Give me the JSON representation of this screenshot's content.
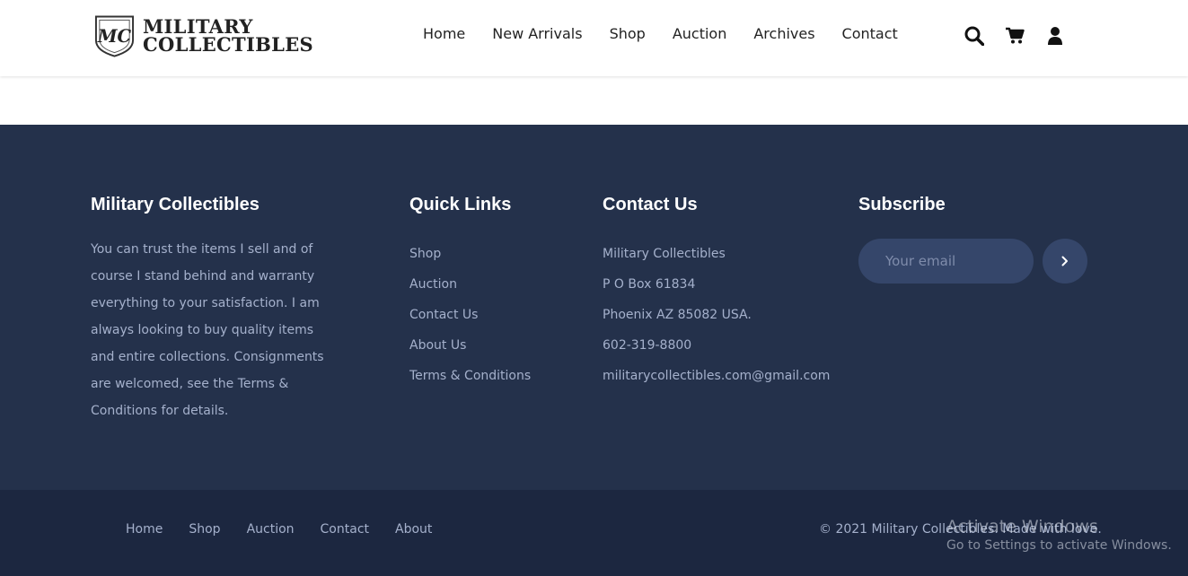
{
  "header": {
    "logo_line1": "MILITARY",
    "logo_line2": "COLLECTIBLES",
    "logo_monogram": "MC",
    "nav": [
      "Home",
      "New Arrivals",
      "Shop",
      "Auction",
      "Archives",
      "Contact"
    ],
    "icons": [
      "search-icon",
      "cart-icon",
      "user-icon"
    ]
  },
  "footer": {
    "about": {
      "title": "Military Collectibles",
      "text": "You can trust the items I sell and of course I stand behind and warranty everything to your satisfaction. I am always looking to buy quality items and entire collections. Consignments are welcomed, see the Terms & Conditions for details."
    },
    "quick_links": {
      "title": "Quick Links",
      "items": [
        "Shop",
        "Auction",
        "Contact Us",
        "About Us",
        "Terms & Conditions"
      ]
    },
    "contact": {
      "title": "Contact Us",
      "lines": [
        "Military Collectibles",
        "P O Box 61834",
        "Phoenix AZ 85082 USA.",
        "602-319-8800",
        "militarycollectibles.com@gmail.com"
      ]
    },
    "subscribe": {
      "title": "Subscribe",
      "placeholder": "Your email",
      "button_icon": "chevron-right-icon"
    }
  },
  "bottom": {
    "links": [
      "Home",
      "Shop",
      "Auction",
      "Contact",
      "About"
    ],
    "copyright": "© 2021 Military Collectibles. Made with love."
  },
  "watermark": {
    "line1": "Activate Windows",
    "line2": "Go to Settings to activate Windows."
  },
  "colors": {
    "footer_bg": "#24314b",
    "footer_bottom_bg": "#1c2740",
    "footer_text": "#a5b1cc",
    "input_bg": "#35466a"
  }
}
